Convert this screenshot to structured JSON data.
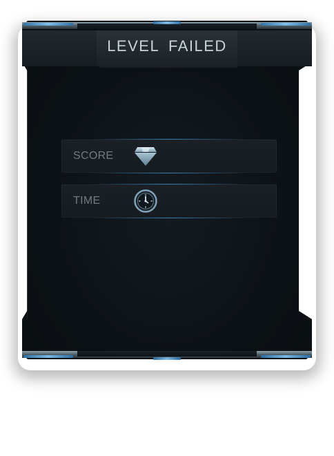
{
  "dialog": {
    "title": "LEVEL FAILED"
  },
  "stats": [
    {
      "label": "SCORE",
      "icon": "diamond-icon",
      "value": ""
    },
    {
      "label": "TIME",
      "icon": "stopwatch-icon",
      "value": ""
    }
  ],
  "colors": {
    "panel_background": "#0d1216",
    "frame_metal": "#8fa3ae",
    "accent_blue": "#7fc4f2",
    "title_text": "#c8d3da",
    "label_text": "#6f7a82"
  }
}
